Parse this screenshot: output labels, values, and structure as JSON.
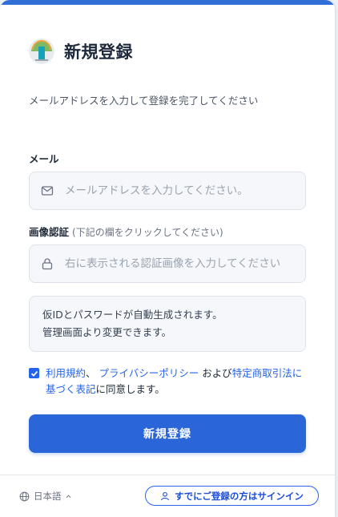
{
  "header": {
    "title": "新規登録",
    "subtitle": "メールアドレスを入力して登録を完了してください"
  },
  "email": {
    "label": "メール",
    "placeholder": "メールアドレスを入力してください。",
    "value": ""
  },
  "captcha": {
    "label": "画像認証",
    "hint": "(下記の欄をクリックしてください)",
    "placeholder": "右に表示される認証画像を入力してください",
    "value": ""
  },
  "info": {
    "line1": "仮IDとパスワードが自動生成されます。",
    "line2": "管理画面より変更できます。"
  },
  "consent": {
    "checked": true,
    "terms": "利用規約",
    "sep1": "、",
    "privacy": "プライバシーポリシー",
    "and": "および",
    "commerce": "特定商取引法に基づく表記",
    "suffix": "に同意します。"
  },
  "submit_label": "新規登録",
  "footer": {
    "language": "日本語",
    "signin_label": "すでにご登録の方はサインイン"
  },
  "colors": {
    "accent": "#2b66d8",
    "link": "#2563eb",
    "field_bg": "#f5f7fa"
  },
  "icons": {
    "logo": "app-logo",
    "email": "mail-icon",
    "captcha": "lock-icon",
    "language": "globe-icon",
    "signin": "person-icon"
  }
}
